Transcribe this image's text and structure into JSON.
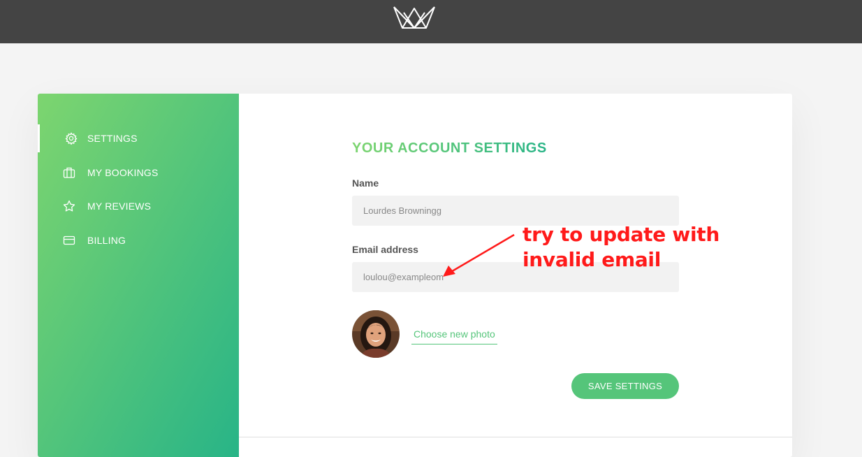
{
  "header": {
    "logo_icon": "crown-logo-icon"
  },
  "sidebar": {
    "items": [
      {
        "label": "Settings",
        "icon": "gear-icon",
        "active": true
      },
      {
        "label": "My bookings",
        "icon": "briefcase-icon",
        "active": false
      },
      {
        "label": "My reviews",
        "icon": "star-icon",
        "active": false
      },
      {
        "label": "Billing",
        "icon": "credit-card-icon",
        "active": false
      }
    ],
    "gradient": [
      "#7dd56f",
      "#28b487"
    ]
  },
  "settings_form": {
    "title": "Your account settings",
    "name_label": "Name",
    "name_value": "Lourdes Browningg",
    "email_label": "Email address",
    "email_value": "loulou@exampleom",
    "photo_link": "Choose new photo",
    "save_button": "Save settings"
  },
  "annotation": {
    "text_line1": "try to update with",
    "text_line2": "invalid email",
    "color": "#ff1a1a"
  },
  "colors": {
    "accent": "#55c57a",
    "topbar": "#444444"
  }
}
